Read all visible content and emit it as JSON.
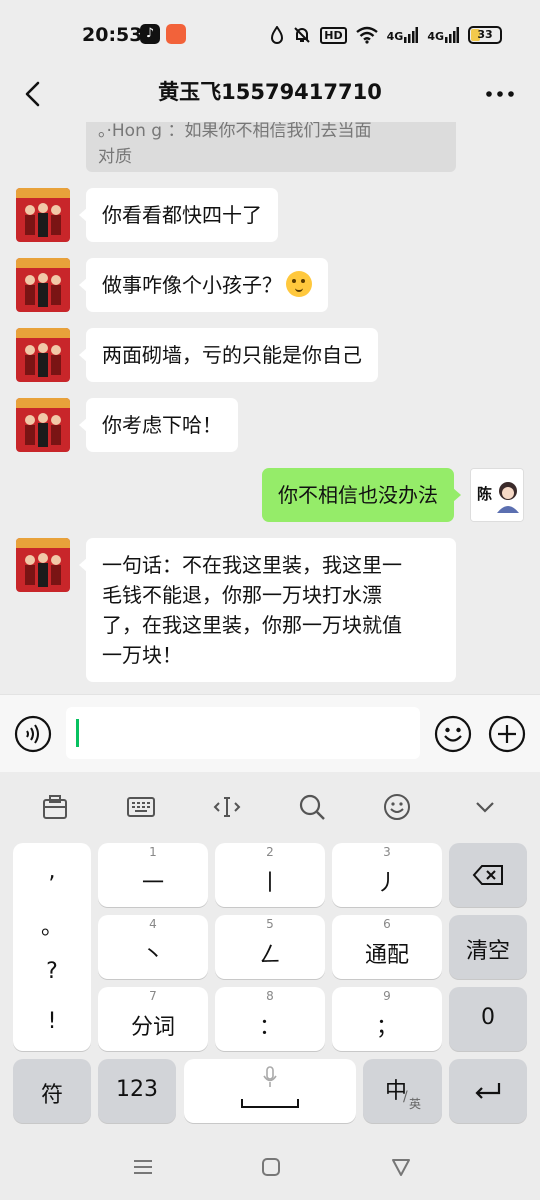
{
  "status_bar": {
    "time": "20:53",
    "hd": "HD",
    "net1": "4G",
    "net2": "4G",
    "battery": "33"
  },
  "header": {
    "title": "黄玉飞15579417710"
  },
  "chat": {
    "quote_line1": "。·Hon g  ：如果你不相信我们去当面",
    "quote_line2": "对质",
    "messages": [
      {
        "text": "你看看都快四十了"
      },
      {
        "text": "做事咋像个小孩子？"
      },
      {
        "text": "两面砌墙，亏的只能是你自己"
      },
      {
        "text": "你考虑下哈！"
      },
      {
        "text": "你不相信也没办法"
      },
      {
        "lines": [
          "一句话：不在我这里装，我这里一",
          "毛钱不能退，你那一万块打水漂",
          "了，在我这里装，你那一万块就值",
          "一万块！"
        ]
      }
    ],
    "me_avatar_label": "陈"
  },
  "keyboard": {
    "punct": [
      ",",
      "。",
      "?",
      "!"
    ],
    "row1": [
      {
        "num": "1",
        "label": "一"
      },
      {
        "num": "2",
        "label": "丨"
      },
      {
        "num": "3",
        "label": "丿"
      }
    ],
    "row2": [
      {
        "num": "4",
        "label": "丶"
      },
      {
        "num": "5",
        "label": "ㄥ"
      },
      {
        "num": "6",
        "label": "通配"
      }
    ],
    "row3": [
      {
        "num": "7",
        "label": "分词"
      },
      {
        "num": "8",
        "label": "："
      },
      {
        "num": "9",
        "label": "；"
      }
    ],
    "clear": "清空",
    "zero": "0",
    "symbols": "符",
    "numbers": "123",
    "lang_main": "中",
    "lang_sub": "英"
  },
  "colors": {
    "accent_green": "#95ec69",
    "caret_green": "#07c160",
    "background": "#ededed"
  },
  "icons": [
    "back-arrow-icon",
    "more-dots-icon",
    "voice-icon",
    "emoji-icon",
    "plus-icon",
    "backspace-icon",
    "enter-icon",
    "mic-icon"
  ]
}
